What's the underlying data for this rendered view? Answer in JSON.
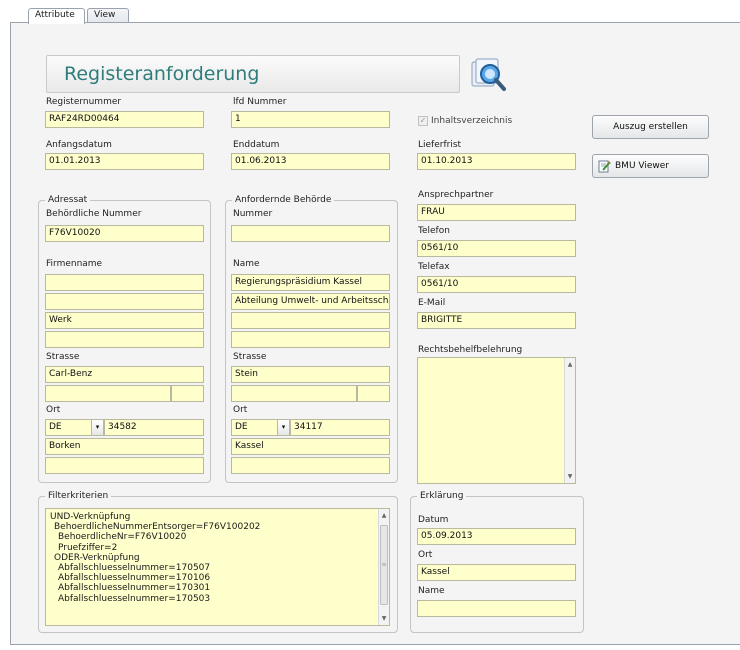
{
  "tabs": [
    "Attribute",
    "View"
  ],
  "title": "Registeranforderung",
  "icon_name": "search-binoculars-icon",
  "accent_color": "#2f7d7a",
  "field_bg": "#ffffcc",
  "fields": {
    "registernummer_label": "Registernummer",
    "registernummer_value": "RAF24RD00464",
    "lfd_label": "lfd Nummer",
    "lfd_value": "1",
    "inhalt_label": "Inhaltsverzeichnis",
    "anfangsdatum_label": "Anfangsdatum",
    "anfangsdatum_value": "01.01.2013",
    "enddatum_label": "Enddatum",
    "enddatum_value": "01.06.2013",
    "lieferfrist_label": "Lieferfrist",
    "lieferfrist_value": "01.10.2013"
  },
  "buttons": {
    "auszug": "Auszug erstellen",
    "bmu": "BMU Viewer"
  },
  "adressat": {
    "group_label": "Adressat",
    "nummer_label": "Behördliche Nummer",
    "nummer_value": "F76V10020",
    "firmenname_label": "Firmenname",
    "name_lines": [
      "",
      "",
      "Werk",
      ""
    ],
    "strasse_label": "Strasse",
    "strasse_value": "Carl-Benz",
    "ort_label": "Ort",
    "country": "DE",
    "plz": "34582",
    "city": "Borken"
  },
  "behoerde": {
    "group_label": "Anfordernde Behörde",
    "nummer_label": "Nummer",
    "nummer_value": "",
    "name_label": "Name",
    "name_lines": [
      "Regierungspräsidium Kassel",
      "Abteilung Umwelt- und Arbeitssch",
      "",
      ""
    ],
    "strasse_label": "Strasse",
    "strasse_value": "Stein",
    "ort_label": "Ort",
    "country": "DE",
    "plz": "34117",
    "city": "Kassel"
  },
  "contact": {
    "ansprech_label": "Ansprechpartner",
    "ansprech_value": "FRAU",
    "telefon_label": "Telefon",
    "telefon_value": "0561/10",
    "telefax_label": "Telefax",
    "telefax_value": "0561/10",
    "email_label": "E-Mail",
    "email_value": "BRIGITTE",
    "rechts_label": "Rechtsbehelfbelehrung"
  },
  "filter": {
    "group_label": "Filterkriterien",
    "lines": [
      "UND-Verknüpfung",
      "  BehoerdlicheNummerEntsorger=F76V100202",
      "    BehoerdlicheNr=F76V10020",
      "    Pruefziffer=2",
      "  ODER-Verknüpfung",
      "    Abfallschluesselnummer=170507",
      "    Abfallschluesselnummer=170106",
      "    Abfallschluesselnummer=170301",
      "    Abfallschluesselnummer=170503"
    ]
  },
  "erklaerung": {
    "group_label": "Erklärung",
    "datum_label": "Datum",
    "datum_value": "05.09.2013",
    "ort_label": "Ort",
    "ort_value": "Kassel",
    "name_label": "Name",
    "name_value": ""
  }
}
